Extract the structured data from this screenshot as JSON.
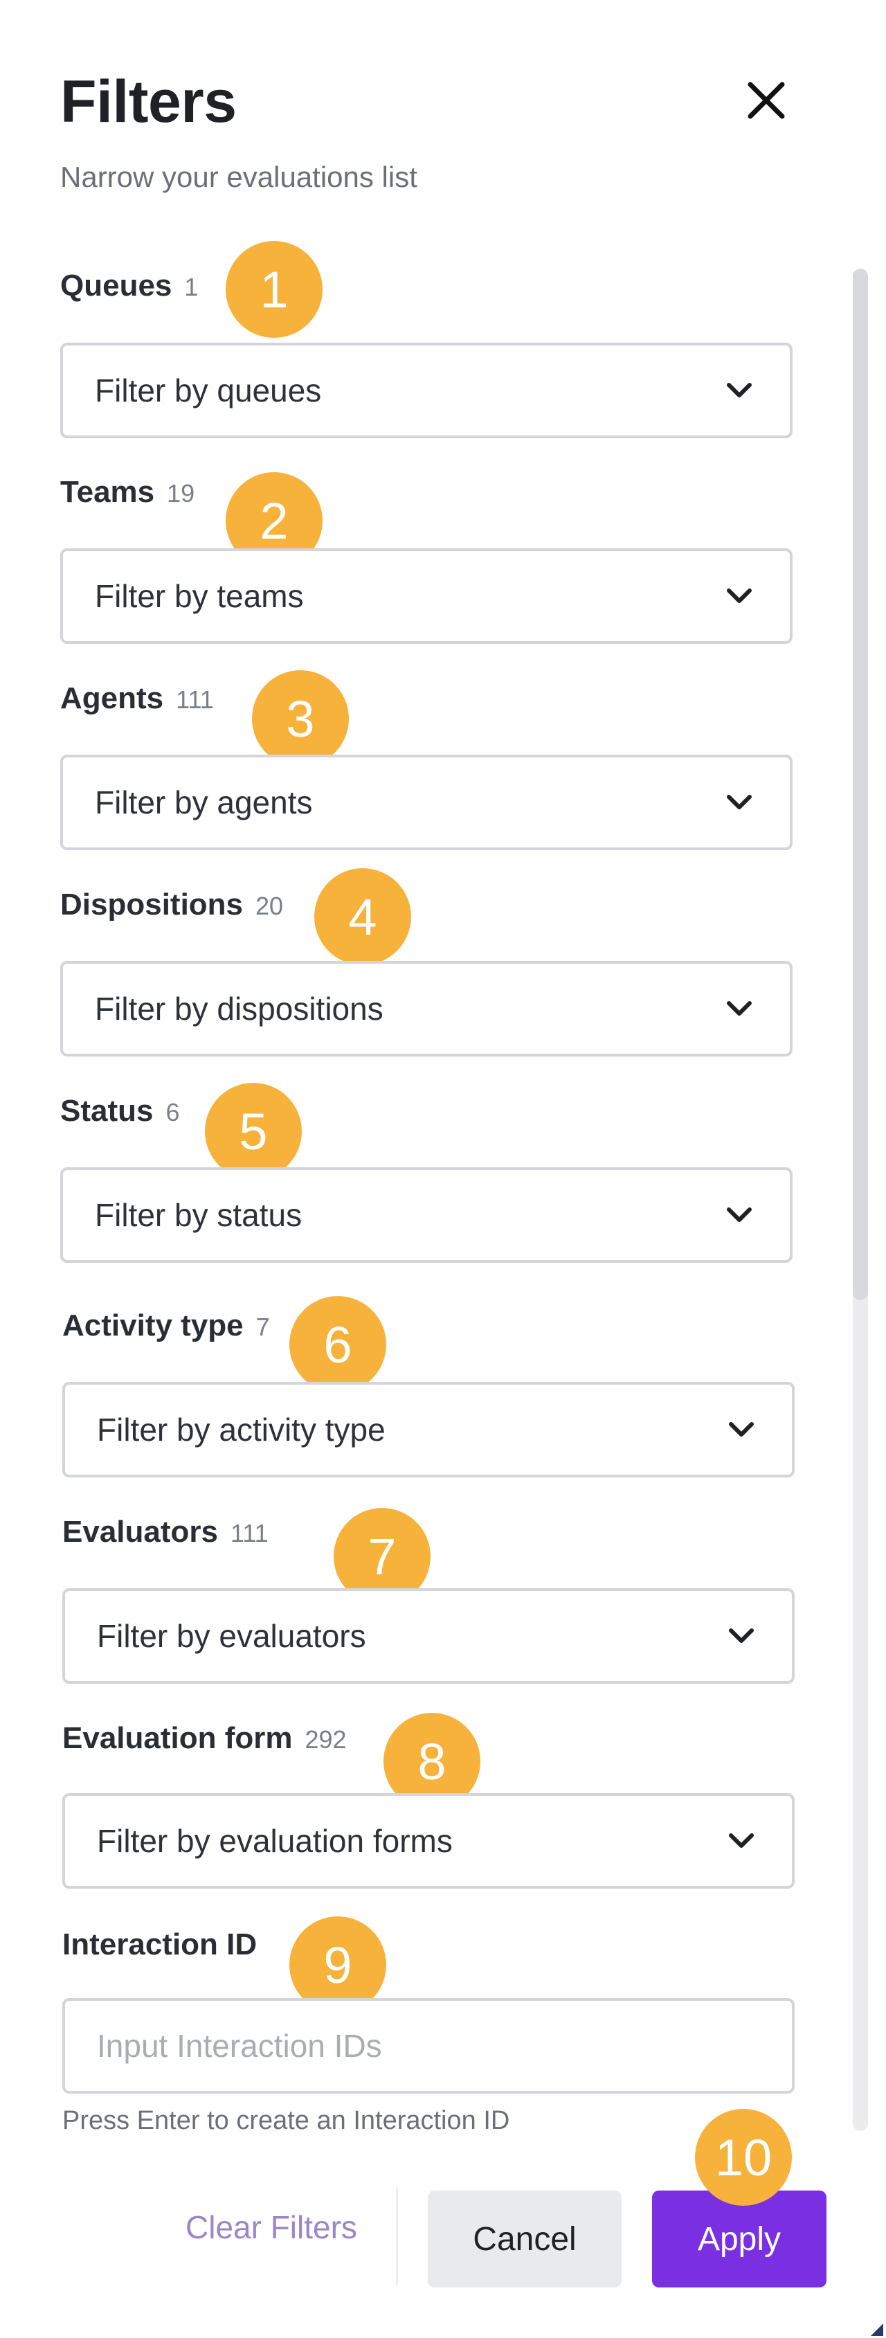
{
  "header": {
    "title": "Filters",
    "subtitle": "Narrow your evaluations list",
    "close_icon": "close-icon"
  },
  "filters": [
    {
      "label": "Queues",
      "count": "1",
      "placeholder": "Filter by queues",
      "badge": "1"
    },
    {
      "label": "Teams",
      "count": "19",
      "placeholder": "Filter by teams",
      "badge": "2"
    },
    {
      "label": "Agents",
      "count": "111",
      "placeholder": "Filter by agents",
      "badge": "3"
    },
    {
      "label": "Dispositions",
      "count": "20",
      "placeholder": "Filter by dispositions",
      "badge": "4"
    },
    {
      "label": "Status",
      "count": "6",
      "placeholder": "Filter by status",
      "badge": "5"
    },
    {
      "label": "Activity type",
      "count": "7",
      "placeholder": "Filter by activity type",
      "badge": "6"
    },
    {
      "label": "Evaluators",
      "count": "111",
      "placeholder": "Filter by evaluators",
      "badge": "7"
    },
    {
      "label": "Evaluation form",
      "count": "292",
      "placeholder": "Filter by evaluation forms",
      "badge": "8"
    }
  ],
  "interaction": {
    "label": "Interaction ID",
    "placeholder": "Input Interaction IDs",
    "helper": "Press Enter to create an Interaction ID",
    "badge": "9"
  },
  "footer": {
    "clear_label": "Clear Filters",
    "cancel_label": "Cancel",
    "apply_label": "Apply",
    "apply_badge": "10"
  },
  "colors": {
    "accent": "#7b2fe3",
    "badge": "#f7b23b",
    "clear_text": "#9c86c9"
  }
}
